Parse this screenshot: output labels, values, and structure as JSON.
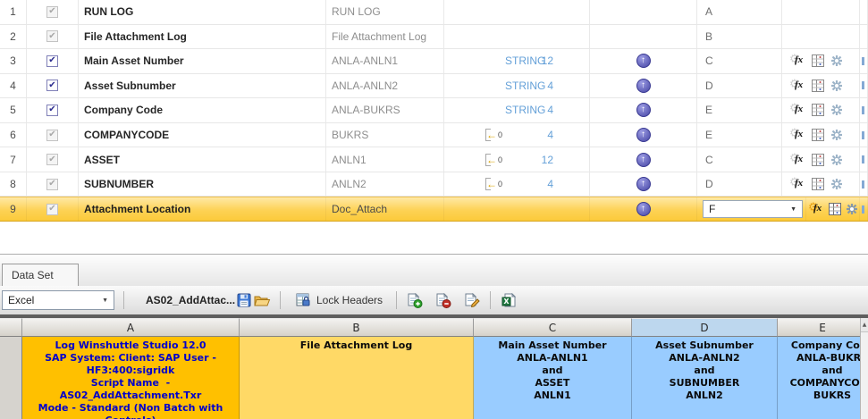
{
  "mapper": {
    "rows": [
      {
        "num": "1",
        "desc": "RUN LOG",
        "field": "RUN LOG",
        "col": "A"
      },
      {
        "num": "2",
        "desc": "File Attachment Log",
        "field": "File Attachment Log",
        "col": "B"
      },
      {
        "num": "3",
        "desc": "Main Asset Number",
        "field": "ANLA-ANLN1",
        "type_label": "STRING",
        "length": "12",
        "col": "C"
      },
      {
        "num": "4",
        "desc": "Asset Subnumber",
        "field": "ANLA-ANLN2",
        "type_label": "STRING",
        "length": "4",
        "col": "D"
      },
      {
        "num": "5",
        "desc": "Company Code",
        "field": "ANLA-BUKRS",
        "type_label": "STRING",
        "length": "4",
        "col": "E"
      },
      {
        "num": "6",
        "desc": "COMPANYCODE",
        "field": "BUKRS",
        "arrow_value": "0",
        "length": "4",
        "col": "E"
      },
      {
        "num": "7",
        "desc": "ASSET",
        "field": "ANLN1",
        "arrow_value": "0",
        "length": "12",
        "col": "C"
      },
      {
        "num": "8",
        "desc": "SUBNUMBER",
        "field": "ANLN2",
        "arrow_value": "0",
        "length": "4",
        "col": "D"
      },
      {
        "num": "9",
        "desc": "Attachment Location",
        "field": "Doc_Attach",
        "col_dropdown": "F"
      }
    ]
  },
  "dataset_tab": {
    "label": "Data Set"
  },
  "toolbar": {
    "source_select": "Excel",
    "file_name": "AS02_AddAttac...",
    "lock_headers_label": "Lock Headers"
  },
  "grid": {
    "col_headers": [
      "A",
      "B",
      "C",
      "D",
      "E"
    ],
    "cell_a": [
      "Log Winshuttle Studio 12.0",
      "SAP System: Client: SAP User -",
      "HF3:400:sigridk",
      "Script Name  -",
      "AS02_AddAttachment.Txr",
      "Mode - Standard (Non Batch with",
      "Controls)"
    ],
    "cell_b": "File Attachment Log",
    "cell_c": [
      "Main Asset Number",
      "ANLA-ANLN1",
      "and",
      "ASSET",
      "ANLN1"
    ],
    "cell_d": [
      "Asset Subnumber",
      "ANLA-ANLN2",
      "and",
      "SUBNUMBER",
      "ANLN2"
    ],
    "cell_e": [
      "Company Code",
      "ANLA-BUKRS",
      "and",
      "COMPANYCODE",
      "BUKRS"
    ]
  },
  "icons": {
    "check_glyph": "✔",
    "upload_arrow_glyph": "↑",
    "default_arrow_glyph": "←",
    "fx_glyph": "fx",
    "gear_glyph": "⚙",
    "dropdown_caret_glyph": "▼",
    "scroll_up_glyph": "▲",
    "excel_glyph": "X"
  },
  "colors": {
    "cell_a_bg": "#FFC000",
    "cell_b_bg": "#FFD966",
    "cell_cde_bg": "#99CCFF",
    "cell_a_text": "#0000CC",
    "selected_row_bg": "#FBCD3F",
    "upload_icon": "#5B5BB4",
    "type_link_blue": "#64A0D8",
    "selected_header_bg": "#BDD7EE"
  }
}
